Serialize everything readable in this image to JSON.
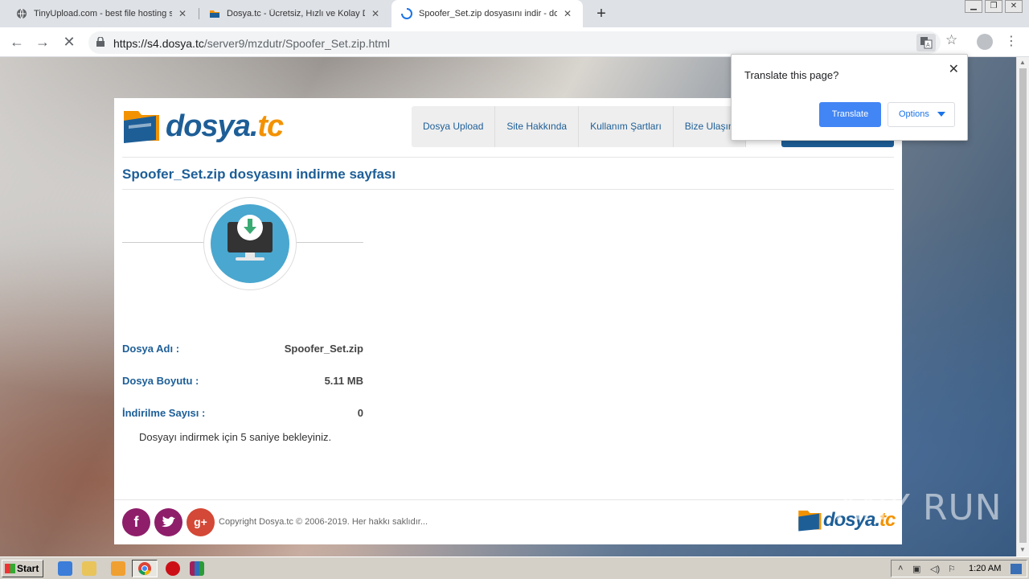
{
  "browser": {
    "tabs": [
      {
        "title": "TinyUpload.com - best file hosting solution",
        "active": false
      },
      {
        "title": "Dosya.tc - Ücretsiz, Hızlı ve Kolay Dosya Upload",
        "active": false
      },
      {
        "title": "Spoofer_Set.zip dosyasını indir - dosya.tc",
        "active": true
      }
    ],
    "url_host": "https://s4.dosya.tc",
    "url_path": "/server9/mzdutr/Spoofer_Set.zip.html"
  },
  "translate_popup": {
    "title": "Translate this page?",
    "translate_label": "Translate",
    "options_label": "Options"
  },
  "site": {
    "logo_main": "dosya.",
    "logo_tld": "tc",
    "nav": [
      "Dosya Upload",
      "Site Hakkında",
      "Kullanım Şartları",
      "Bize Ulaşın"
    ],
    "page_title": "Spoofer_Set.zip dosyasını indirme sayfası",
    "file": {
      "name_label": "Dosya Adı :",
      "name_value": "Spoofer_Set.zip",
      "size_label": "Dosya Boyutu :",
      "size_value": "5.11 MB",
      "downloads_label": "İndirilme Sayısı :",
      "downloads_value": "0"
    },
    "wait_text": "Dosyayı indirmek için 5 saniye bekleyiniz.",
    "copyright": "Copyright Dosya.tc © 2006-2019. Her hakkı saklıdır...",
    "social": {
      "facebook": "f",
      "google_plus": "g+"
    }
  },
  "watermark": "ANY RUN",
  "taskbar": {
    "start_label": "Start",
    "clock": "1:20 AM"
  },
  "colors": {
    "brand_blue": "#1d5e97",
    "brand_orange": "#f39200",
    "translate_blue": "#4285f4",
    "facebook": "#8e1e6a",
    "twitter": "#8e1e6a",
    "google_plus": "#d34836"
  }
}
